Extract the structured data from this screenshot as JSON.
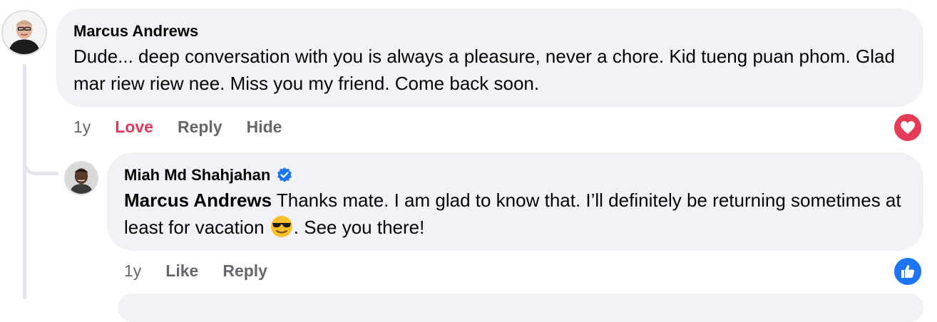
{
  "comments": [
    {
      "author": "Marcus Andrews",
      "text": "Dude... deep conversation with you is always a pleasure, never a chore. Kid tueng puan phom. Glad mar riew riew nee. Miss you my friend. Come back soon.",
      "time": "1y",
      "reaction_label": "Love",
      "reply_label": "Reply",
      "hide_label": "Hide",
      "reaction_icon": "heart-icon",
      "reaction_color": "#e43b58"
    },
    {
      "author": "Miah Md Shahjahan",
      "verified": true,
      "mention": "Marcus Andrews",
      "text_before_emoji": " Thanks mate. I am glad to know that. I’ll definitely be returning sometimes at least for vacation ",
      "emoji": "smiling-face-with-sunglasses",
      "text_after_emoji": ". See you there!",
      "time": "1y",
      "like_label": "Like",
      "reply_label": "Reply",
      "reaction_icon": "thumbs-up-icon",
      "reaction_color": "#1d75f2"
    }
  ],
  "colors": {
    "bubble": "#f0f2f5",
    "secondary_text": "#65676b",
    "love_text": "#e4375a"
  }
}
